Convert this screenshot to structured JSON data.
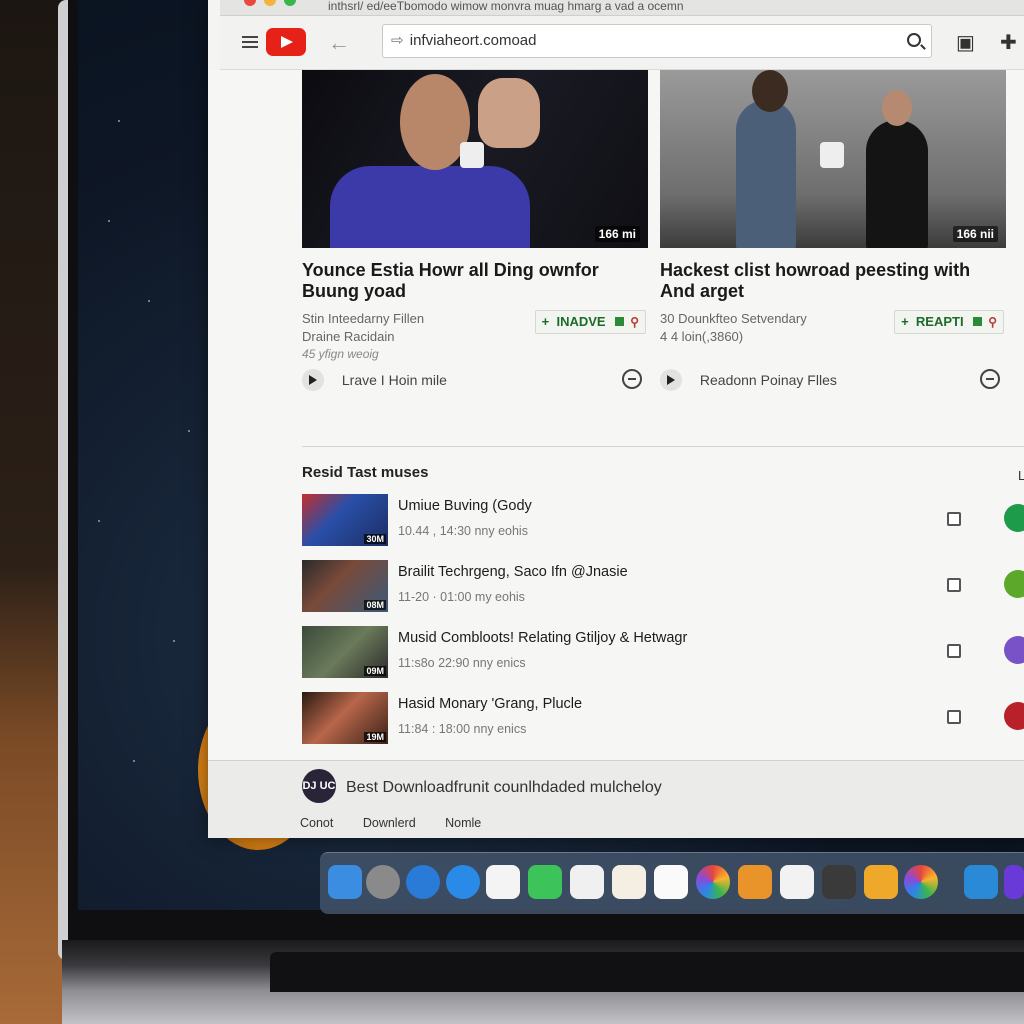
{
  "browser": {
    "tab_title": "inthsrl/ ed/eeTbomodo wimow monvra muag hmarg a  vad a ocemn",
    "address": "infviaheort.comoad"
  },
  "cards": [
    {
      "duration": "166 mi",
      "title": "Younce Estia Howr all Ding ownfor Buung yoad",
      "meta1": "Stin Inteedarny Fillen",
      "meta2": "Draine Racidain",
      "meta3": "45 yfign weoig",
      "action_label": "INADVE",
      "footer_label": "Lrave I Hoin mile"
    },
    {
      "duration": "166 nii",
      "title": "Hackest clist howroad peesting with And arget",
      "meta1": "30 Dounkfteo Setvendary",
      "meta2": "4 4 loin(,3860)",
      "meta3": "",
      "action_label": "REAPTI",
      "footer_label": "Readonn Poinay Flles"
    }
  ],
  "section": {
    "heading": "Resid Tast muses",
    "right_label": "L"
  },
  "list": [
    {
      "title": "Umiue Buving (Gody",
      "meta": "10.44 , 14:30 nny eohis",
      "tag": "30M"
    },
    {
      "title": "Brailit Techrgeng, Saco Ifn @Jnasie",
      "meta": "11-20 · 01:00 my eohis",
      "tag": "08M"
    },
    {
      "title": "Musid Combloots! Relating Gtiljoy & Hetwagr",
      "meta": "11:s8o 22:90 nny enics",
      "tag": "09M"
    },
    {
      "title": "Hasid Monary 'Grang, Plucle",
      "meta": "11:84 : 18:00 nny enics",
      "tag": "19M"
    }
  ],
  "bottom": {
    "avatar_text": "DJ UC",
    "text": "Best Downloadfrunit counlhdaded mulcheloy",
    "links": [
      "Conot",
      "Downlerd",
      "Nomle"
    ]
  },
  "colors": {
    "accent_red": "#e62117",
    "action_green": "#1c6b2a"
  }
}
